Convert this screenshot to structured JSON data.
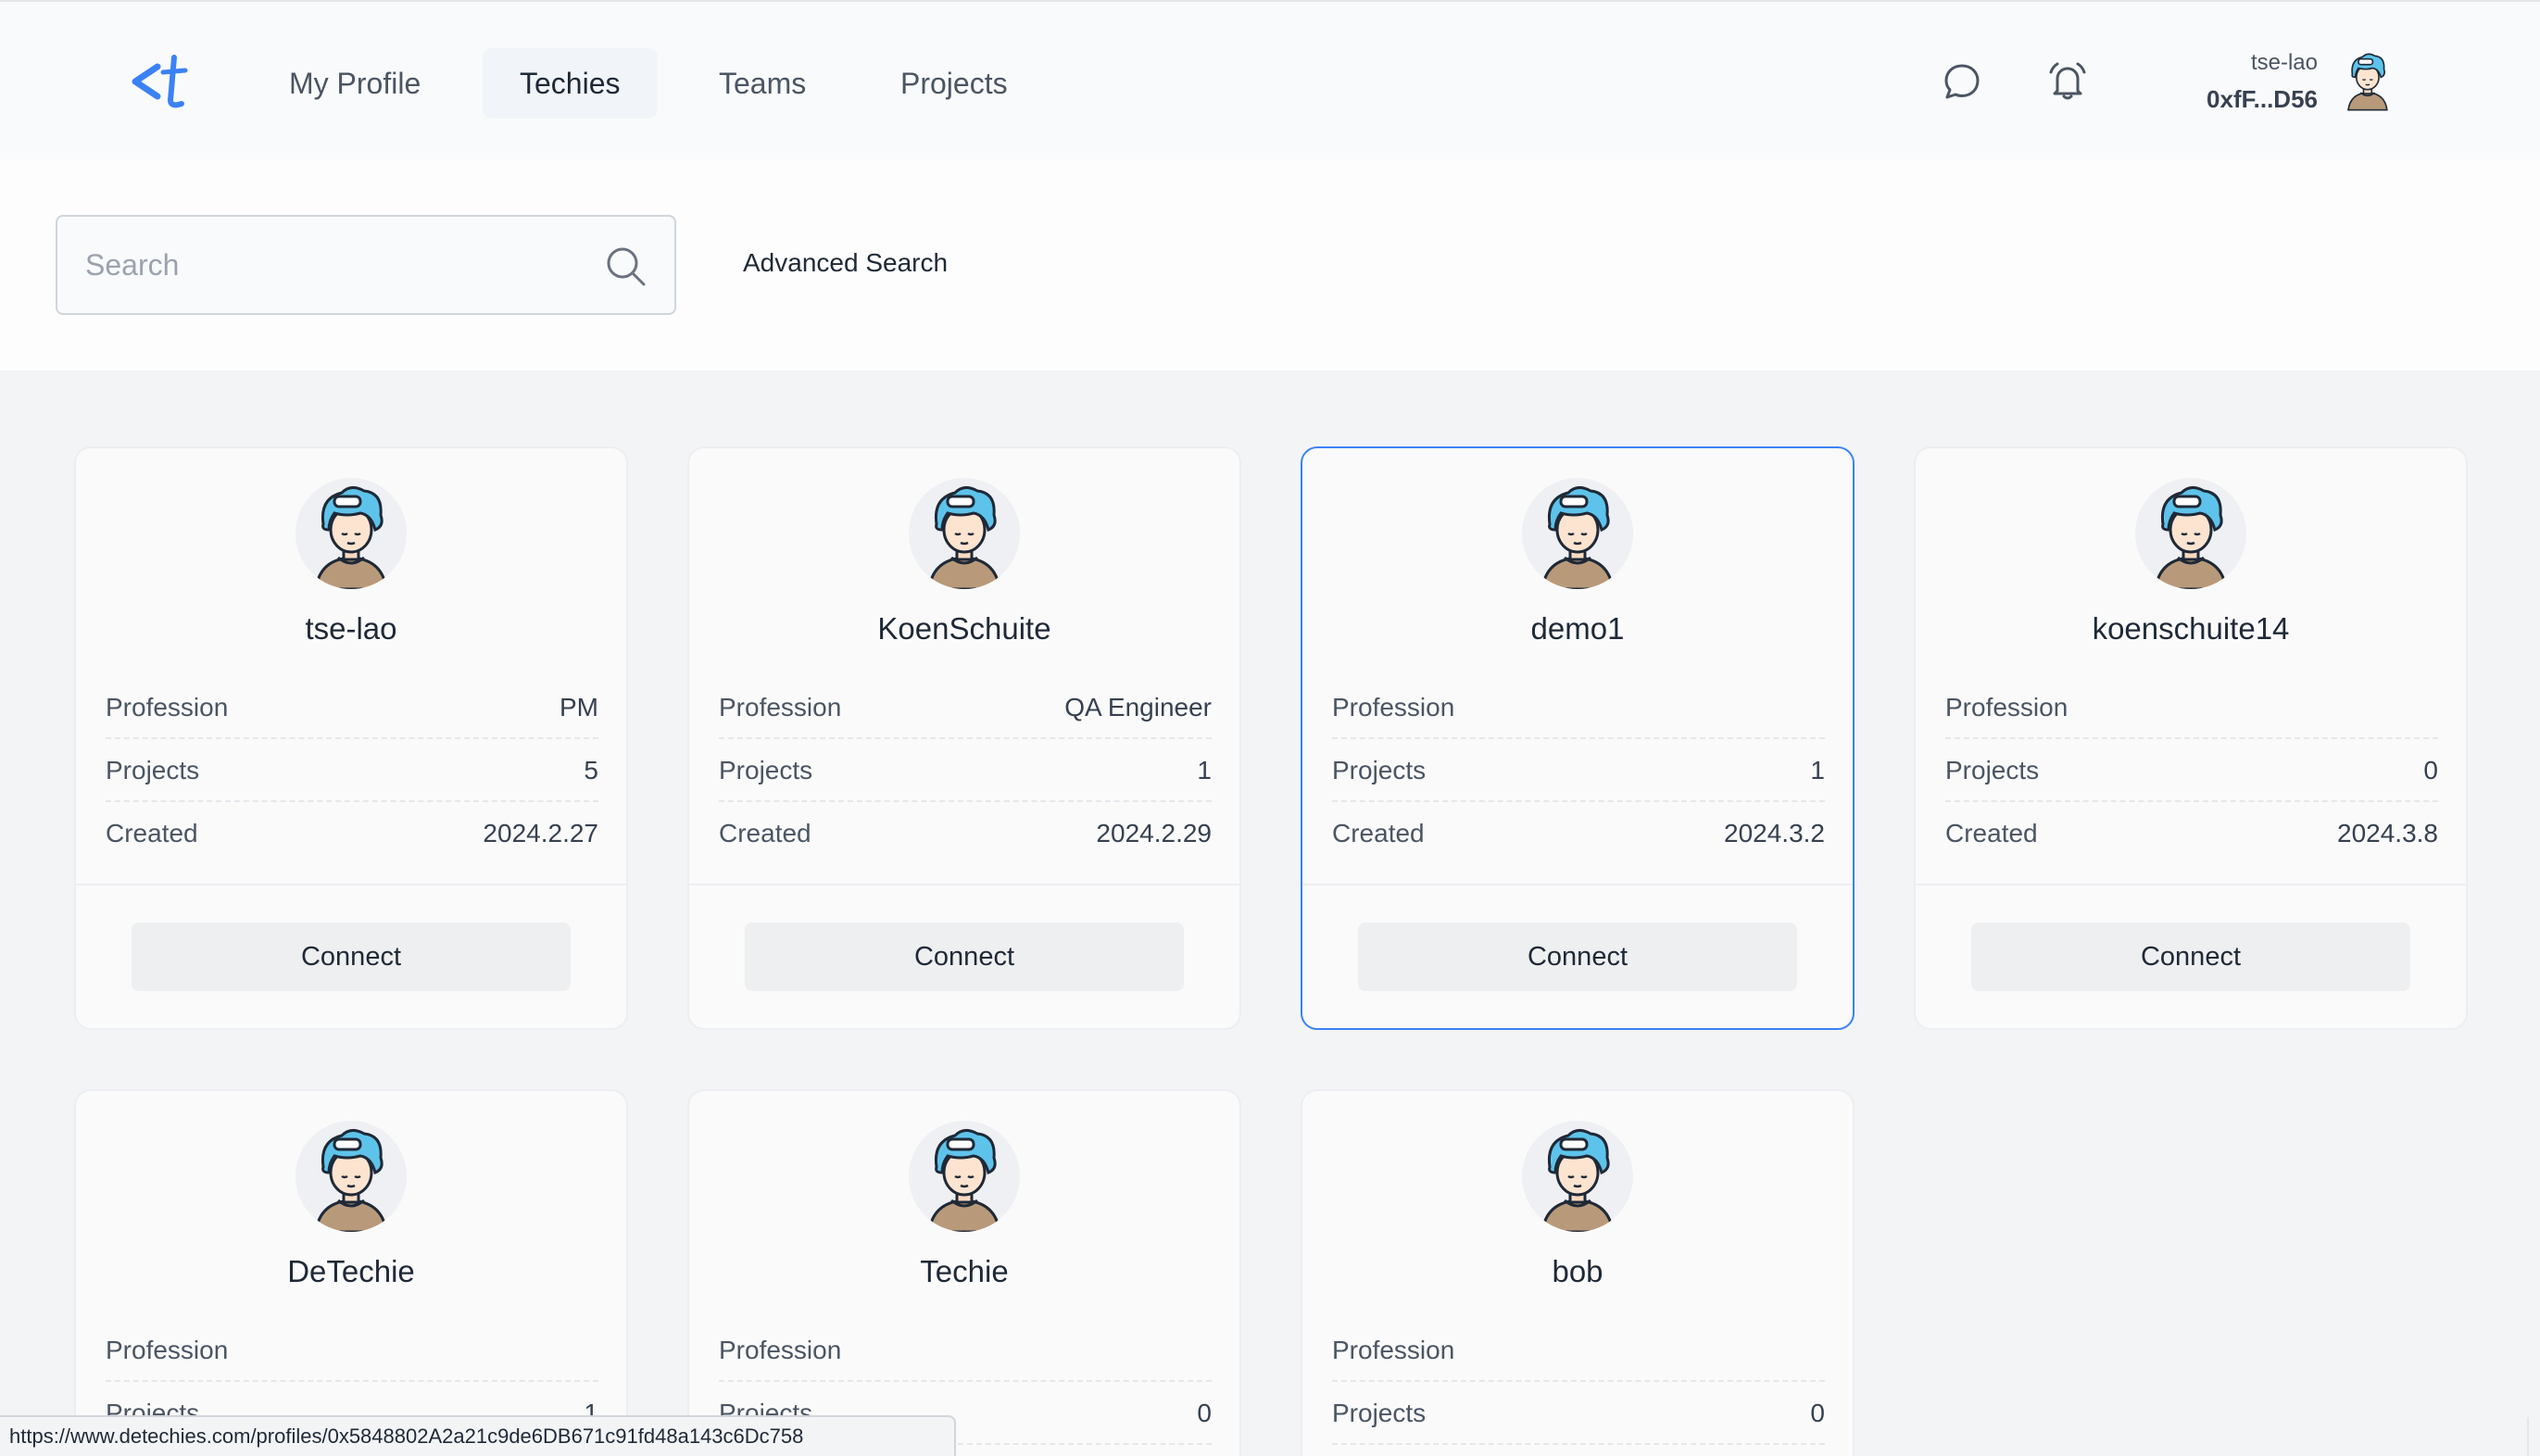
{
  "header": {
    "nav": [
      {
        "label": "My Profile"
      },
      {
        "label": "Techies",
        "active": true
      },
      {
        "label": "Teams"
      },
      {
        "label": "Projects"
      }
    ],
    "icons": {
      "logo": "detechies-logo",
      "chat": "chat-bubble-icon",
      "bell": "bell-icon"
    },
    "user": {
      "name": "tse-lao",
      "address": "0xfF...D56"
    }
  },
  "search": {
    "placeholder": "Search",
    "value": "",
    "advanced_label": "Advanced Search"
  },
  "colors": {
    "accent": "#3b82f6",
    "background": "#f3f4f6",
    "card": "#fafafa",
    "button": "#eeeff1"
  },
  "techies": [
    {
      "name": "tse-lao",
      "profession_label": "Profession",
      "profession": "PM",
      "projects_label": "Projects",
      "projects": "5",
      "created_label": "Created",
      "created": "2024.2.27",
      "button": "Connect"
    },
    {
      "name": "KoenSchuite",
      "profession_label": "Profession",
      "profession": "QA Engineer",
      "projects_label": "Projects",
      "projects": "1",
      "created_label": "Created",
      "created": "2024.2.29",
      "button": "Connect"
    },
    {
      "name": "demo1",
      "profession_label": "Profession",
      "profession": "",
      "projects_label": "Projects",
      "projects": "1",
      "created_label": "Created",
      "created": "2024.3.2",
      "button": "Connect",
      "selected": true
    },
    {
      "name": "koenschuite14",
      "profession_label": "Profession",
      "profession": "",
      "projects_label": "Projects",
      "projects": "0",
      "created_label": "Created",
      "created": "2024.3.8",
      "button": "Connect"
    },
    {
      "name": "DeTechie",
      "profession_label": "Profession",
      "profession": "",
      "projects_label": "Projects",
      "projects": "1"
    },
    {
      "name": "Techie",
      "profession_label": "Profession",
      "profession": "",
      "projects_label": "Projects",
      "projects": "0"
    },
    {
      "name": "bob",
      "profession_label": "Profession",
      "profession": "",
      "projects_label": "Projects",
      "projects": "0"
    }
  ],
  "status_bar": {
    "url": "https://www.detechies.com/profiles/0x5848802A2a21c9de6DB671c91fd48a143c6Dc758"
  }
}
